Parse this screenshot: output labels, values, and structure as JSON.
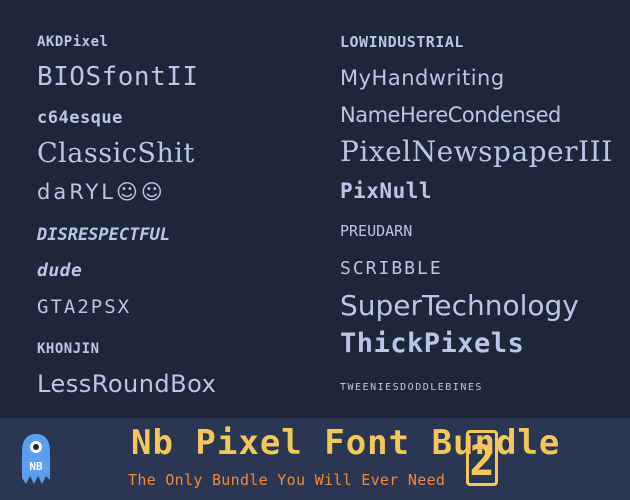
{
  "fonts_left": [
    {
      "name": "AKDPixel"
    },
    {
      "name": "BIOSfontII"
    },
    {
      "name": "c64esque"
    },
    {
      "name": "ClassicShit"
    },
    {
      "name": "daRYL☺☺"
    },
    {
      "name": "DISRESPECTFUL"
    },
    {
      "name": "dude"
    },
    {
      "name": "GTA2PSX"
    },
    {
      "name": "KHONJIN"
    },
    {
      "name": "LessRoundBox"
    }
  ],
  "fonts_right": [
    {
      "name": "LOWINDUSTRIAL"
    },
    {
      "name": "MyHandwriting"
    },
    {
      "name": "NameHereCondensed"
    },
    {
      "name": "PixelNewspaperIII"
    },
    {
      "name": "PixNull"
    },
    {
      "name": "PREUDARN"
    },
    {
      "name": "SCRIBBLE"
    },
    {
      "name": "SuperTechnology"
    },
    {
      "name": "ThickPixels"
    },
    {
      "name": "TWEENIESDODDLEBINES"
    }
  ],
  "banner": {
    "title": "Nb Pixel Font Bundle",
    "number": "2",
    "subtitle": "The Only Bundle You Will Ever Need",
    "logo_text": "NB"
  },
  "colors": {
    "background": "#1f2638",
    "footer": "#2b3652",
    "font_text": "#b9c6e6",
    "title": "#f2c85a",
    "subtitle": "#f08a3a",
    "logo": "#5aa0ee"
  }
}
